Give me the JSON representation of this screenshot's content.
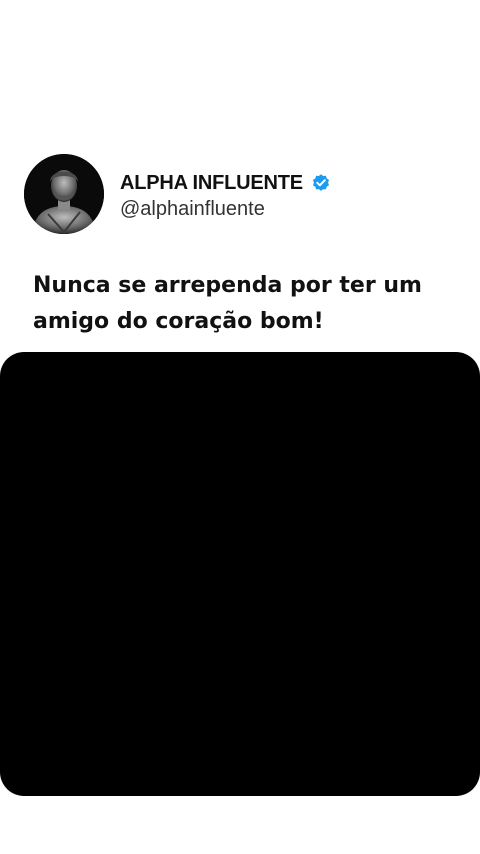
{
  "post": {
    "author": {
      "display_name": "ALPHA INFLUENTE",
      "handle": "@alphainfluente",
      "verified": true,
      "verified_icon": "verified-badge-icon",
      "avatar": "statue-bust-avatar"
    },
    "text": "Nunca se arrependa por ter um amigo do coração bom!",
    "media": {
      "background_color": "#000000"
    }
  },
  "colors": {
    "background": "#ffffff",
    "text": "#111111",
    "verified_badge": "#1d9bf0"
  }
}
